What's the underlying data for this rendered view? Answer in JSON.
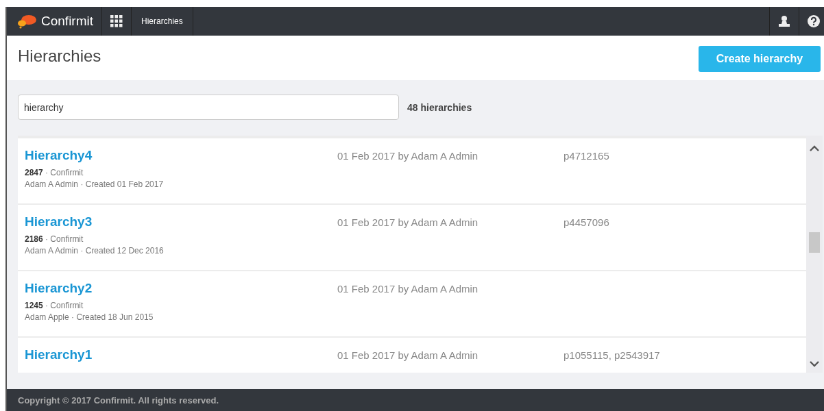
{
  "topbar": {
    "brand": "Confirmit",
    "section": "Hierarchies"
  },
  "page_title": "Hierarchies",
  "create_button": "Create hierarchy",
  "search": {
    "value": "hierarchy"
  },
  "count": "48 hierarchies",
  "rows": [
    {
      "name": "Hierarchy4",
      "meta": "**2847** · Confirmit",
      "created": "Adam A Admin · Created 01 Feb 2017",
      "modified": "01 Feb 2017 by Adam A Admin",
      "projects": "p4712165"
    },
    {
      "name": "Hierarchy3",
      "meta": "**2186** · Confirmit",
      "created": "Adam A Admin · Created 12 Dec 2016",
      "modified": "01 Feb 2017 by Adam A Admin",
      "projects": "p4457096"
    },
    {
      "name": "Hierarchy2",
      "meta": "**1245** · Confirmit",
      "created": "Adam Apple · Created 18 Jun 2015",
      "modified": "01 Feb 2017 by Adam A Admin"
    },
    {
      "name": "Hierarchy1",
      "modified": "01 Feb 2017 by Adam A Admin",
      "projects": "p1055115, p2543917"
    }
  ],
  "footer": "Copyright © 2017 Confirmit. All rights reserved."
}
